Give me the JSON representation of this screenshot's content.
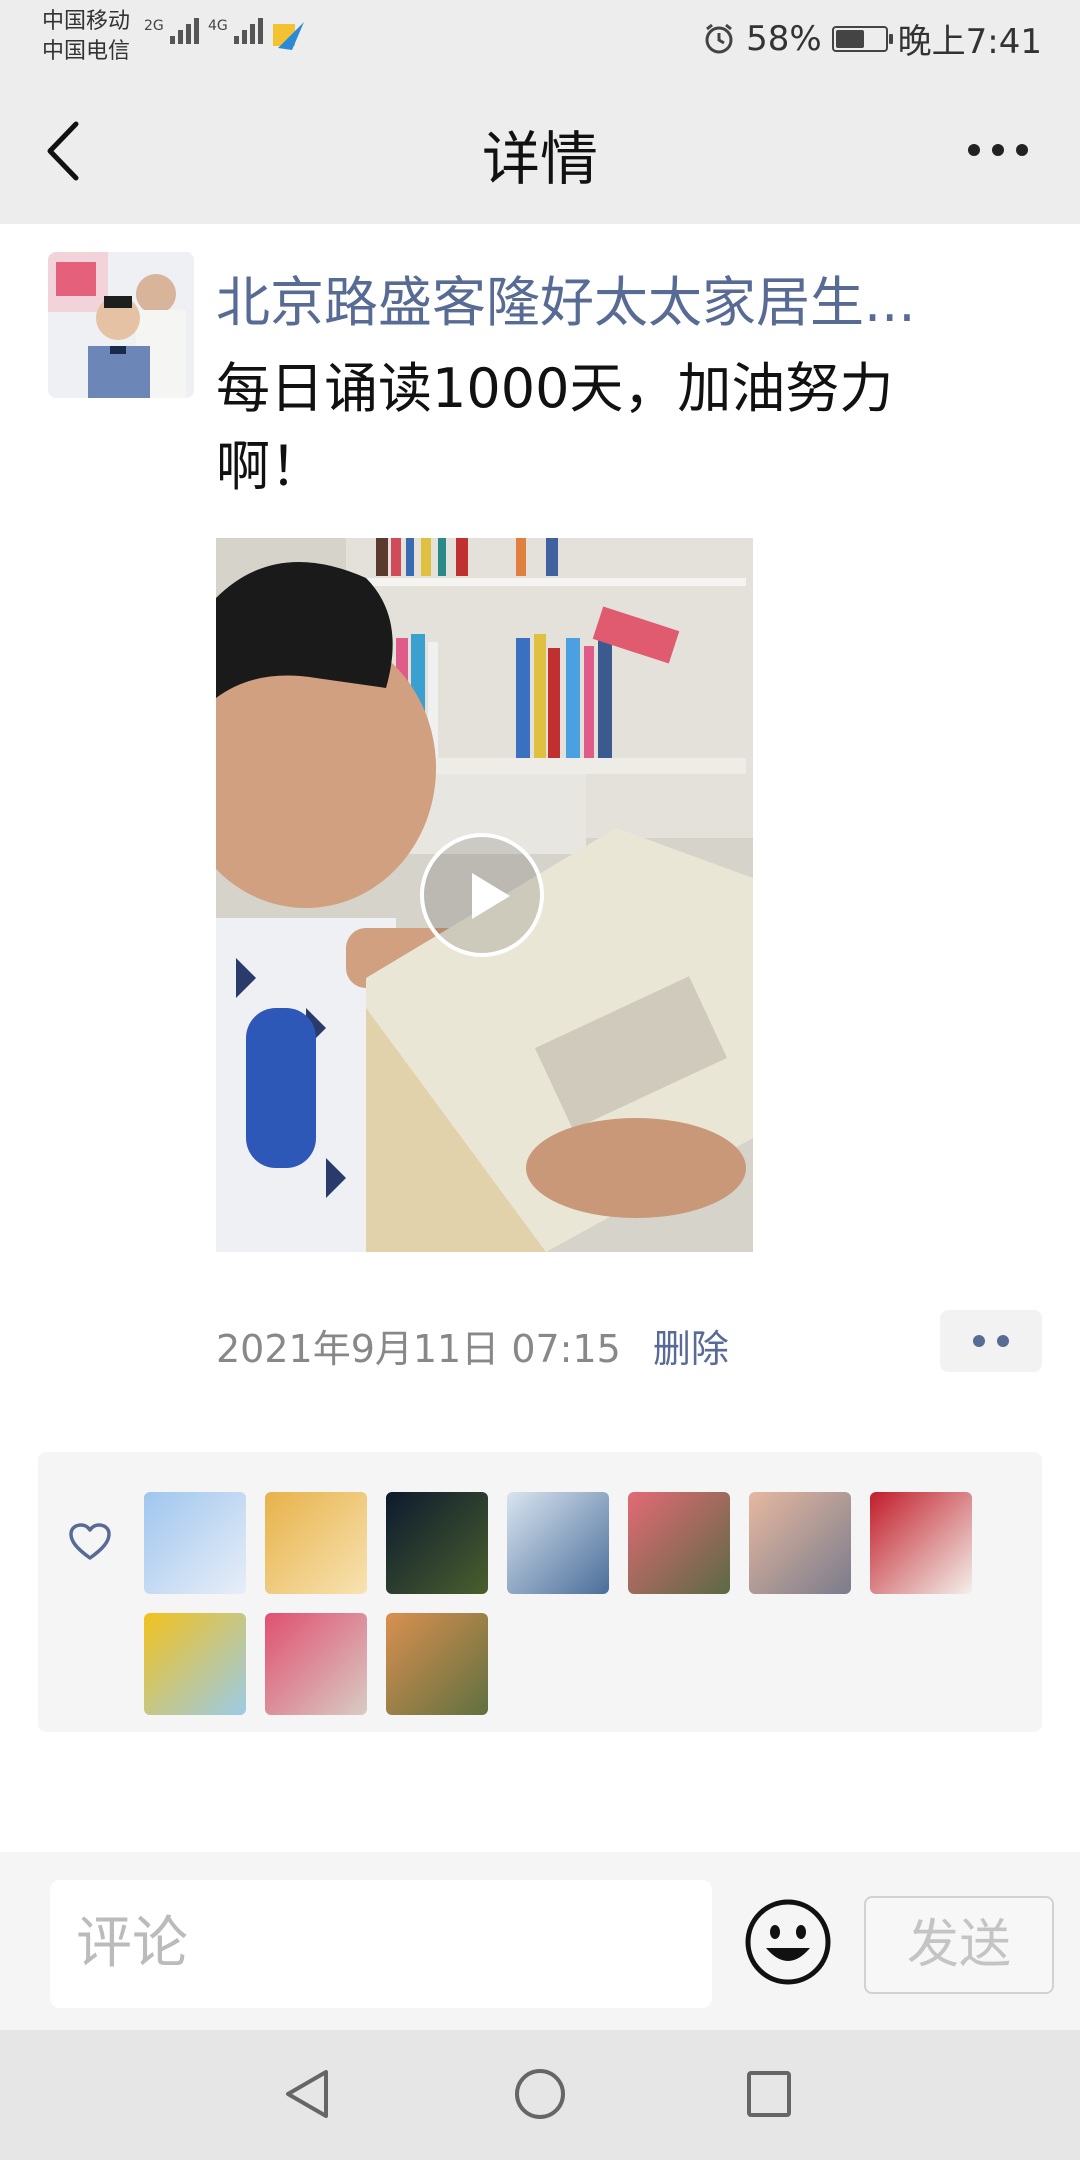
{
  "status_bar": {
    "carrier1": "中国移动",
    "carrier2": "中国电信",
    "net1": "2G",
    "net2": "4G",
    "battery_pct": "58%",
    "battery_level": 0.58,
    "time": "晚上7:41"
  },
  "nav": {
    "title": "详情"
  },
  "post": {
    "author": "北京路盛客隆好太太家居生...",
    "text": "每日诵读1000天，加油努力啊！",
    "timestamp": "2021年9月11日 07:15",
    "delete_label": "删除"
  },
  "likes": {
    "avatars": [
      {
        "name": "whale-sky-avatar",
        "colors": [
          "#9fc6ee",
          "#e8eef8"
        ]
      },
      {
        "name": "sunflower-girl-avatar",
        "colors": [
          "#e7b24a",
          "#f7e3b2"
        ]
      },
      {
        "name": "night-lights-avatar",
        "colors": [
          "#0c1a2e",
          "#4a5f2e"
        ]
      },
      {
        "name": "man-flag-avatar",
        "colors": [
          "#d9e4ef",
          "#4a6e9a"
        ]
      },
      {
        "name": "pink-flowers-avatar",
        "colors": [
          "#e36a74",
          "#5a6a45"
        ]
      },
      {
        "name": "sunset-towers-avatar",
        "colors": [
          "#e6b8a0",
          "#7a7c8c"
        ]
      },
      {
        "name": "red-bouquet-avatar",
        "colors": [
          "#c21d2a",
          "#f3f0ea"
        ]
      },
      {
        "name": "sunflower-avatar",
        "colors": [
          "#f2c21d",
          "#9bcbe8"
        ]
      },
      {
        "name": "red-blossom-avatar",
        "colors": [
          "#e05070",
          "#d8ccc4"
        ]
      },
      {
        "name": "cat-avatar",
        "colors": [
          "#d99050",
          "#5f7040"
        ]
      }
    ]
  },
  "comment_bar": {
    "placeholder": "评论",
    "send_label": "发送"
  },
  "colors": {
    "link": "#576b95",
    "bar_bg": "#ededed"
  }
}
